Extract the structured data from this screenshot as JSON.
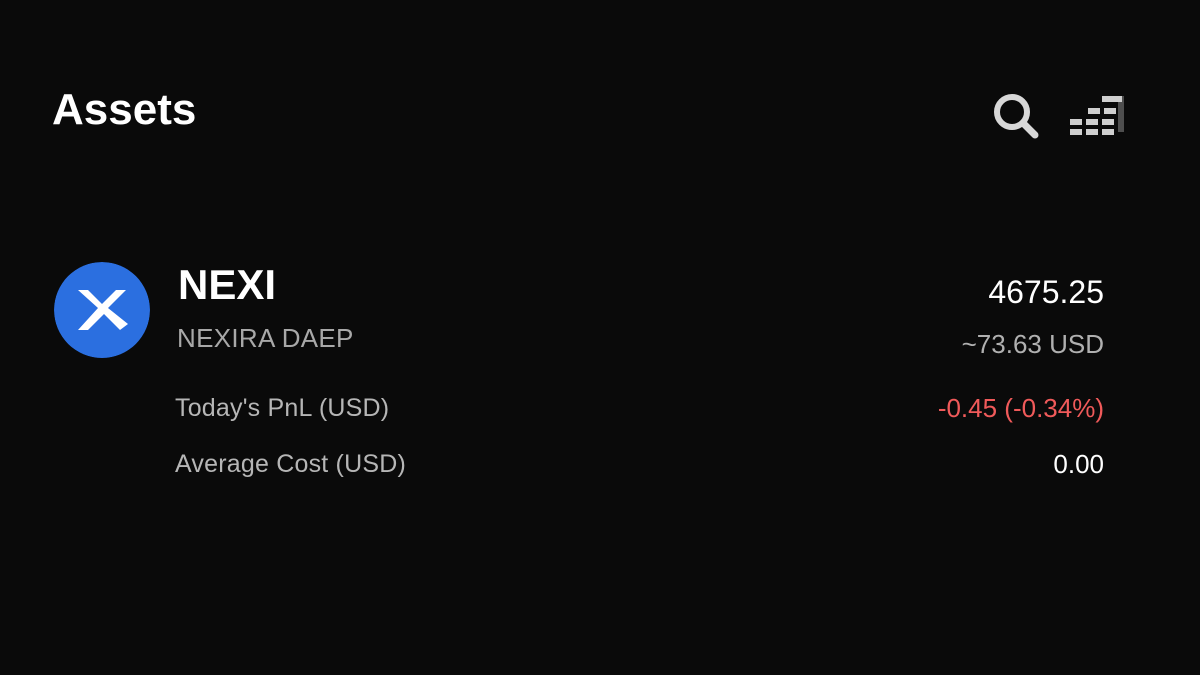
{
  "header": {
    "title": "Assets"
  },
  "icons": {
    "search": "search-icon",
    "filter": "filter-sort-icon"
  },
  "asset": {
    "ticker": "NEXI",
    "name": "NEXIRA DAEP",
    "logo_icon": "nexira-logo-icon",
    "logo_color": "#2b6fe0",
    "balance": "4675.25",
    "balance_usd": "~73.63 USD",
    "pnl_label": "Today's PnL (USD)",
    "pnl_value": "-0.45 (-0.34%)",
    "pnl_color": "#f05a5a",
    "avg_cost_label": "Average Cost (USD)",
    "avg_cost_value": "0.00"
  }
}
